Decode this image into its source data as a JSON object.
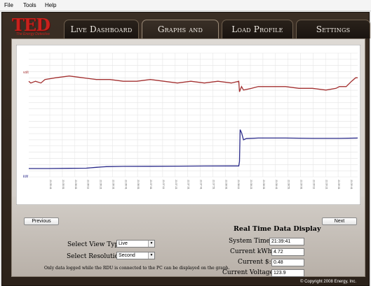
{
  "menu": {
    "file": "File",
    "tools": "Tools",
    "help": "Help"
  },
  "logo": {
    "text": "TED",
    "tagline": "The Energy Detective"
  },
  "tabs": [
    {
      "label": "Live Dashboard",
      "active": false
    },
    {
      "label": "Graphs and Charts",
      "active": true
    },
    {
      "label": "Load Profile",
      "active": false
    },
    {
      "label": "Settings",
      "active": false
    }
  ],
  "nav": {
    "previous": "Previous",
    "next": "Next"
  },
  "realtime": {
    "title": "Real Time Data Display",
    "system_time_label": "System Time:",
    "system_time": "21:39:41",
    "current_kwh_label": "Current kWh:",
    "current_kwh": "4.72",
    "current_cost_label": "Current $:",
    "current_cost": "0.48",
    "current_voltage_label": "Current Voltage:",
    "current_voltage": "123.9"
  },
  "controls": {
    "view_type_label": "Select View Type:",
    "view_type": "Live",
    "resolution_label": "Select Resolution:",
    "resolution": "Second",
    "note": "Only data logged while the RDU is connected to the PC can be displayed on the graph."
  },
  "copyright": "© Copyright 2008 Energy, Inc.",
  "colors": {
    "voltage": "#a33030",
    "kwh": "#2a2a8a",
    "tab_bg": "#1e1813",
    "brand": "#c8201c"
  },
  "chart_data": {
    "type": "line",
    "series": [
      {
        "name": "volt",
        "axis": "upper",
        "points": [
          [
            0,
            124.4
          ],
          [
            3,
            124.3
          ],
          [
            10,
            124.4
          ],
          [
            18,
            124.3
          ],
          [
            24,
            124.5
          ],
          [
            40,
            124.6
          ],
          [
            60,
            124.7
          ],
          [
            80,
            124.6
          ],
          [
            100,
            124.5
          ],
          [
            120,
            124.5
          ],
          [
            140,
            124.4
          ],
          [
            160,
            124.4
          ],
          [
            180,
            124.5
          ],
          [
            200,
            124.4
          ],
          [
            220,
            124.3
          ],
          [
            240,
            124.4
          ],
          [
            260,
            124.3
          ],
          [
            280,
            124.4
          ],
          [
            300,
            124.3
          ],
          [
            311,
            124.4
          ],
          [
            312,
            123.8
          ],
          [
            315,
            124.1
          ],
          [
            318,
            123.9
          ],
          [
            330,
            124.0
          ],
          [
            340,
            124.1
          ],
          [
            360,
            124.1
          ],
          [
            380,
            124.1
          ],
          [
            400,
            124.0
          ],
          [
            420,
            124.0
          ],
          [
            440,
            123.9
          ],
          [
            455,
            124.0
          ],
          [
            460,
            124.1
          ],
          [
            470,
            124.1
          ],
          [
            478,
            124.4
          ],
          [
            484,
            124.6
          ],
          [
            487,
            124.6
          ]
        ]
      },
      {
        "name": "kW",
        "axis": "lower",
        "points": [
          [
            0,
            1.2
          ],
          [
            30,
            1.2
          ],
          [
            60,
            1.22
          ],
          [
            85,
            1.23
          ],
          [
            100,
            1.3
          ],
          [
            110,
            1.34
          ],
          [
            115,
            1.36
          ],
          [
            140,
            1.38
          ],
          [
            180,
            1.39
          ],
          [
            220,
            1.4
          ],
          [
            260,
            1.41
          ],
          [
            300,
            1.42
          ],
          [
            311,
            1.42
          ],
          [
            312,
            1.8
          ],
          [
            313,
            4.45
          ],
          [
            315,
            4.2
          ],
          [
            318,
            3.6
          ],
          [
            322,
            3.7
          ],
          [
            340,
            3.75
          ],
          [
            380,
            3.75
          ],
          [
            420,
            3.72
          ],
          [
            460,
            3.72
          ],
          [
            487,
            3.75
          ]
        ]
      }
    ],
    "x_tick_labels": [
      "21:35:41",
      "21:35:51",
      "21:36:01",
      "21:36:11",
      "21:36:21",
      "21:36:31",
      "21:36:41",
      "21:36:51",
      "21:37:01",
      "21:37:11",
      "21:37:21",
      "21:37:31",
      "21:37:41",
      "21:37:51",
      "21:38:01",
      "21:38:11",
      "21:38:21",
      "21:38:31",
      "21:38:41",
      "21:38:51",
      "21:39:01",
      "21:39:11",
      "21:39:21",
      "21:39:31",
      "21:39:41"
    ],
    "grid": true,
    "x_range": [
      0,
      487
    ]
  }
}
